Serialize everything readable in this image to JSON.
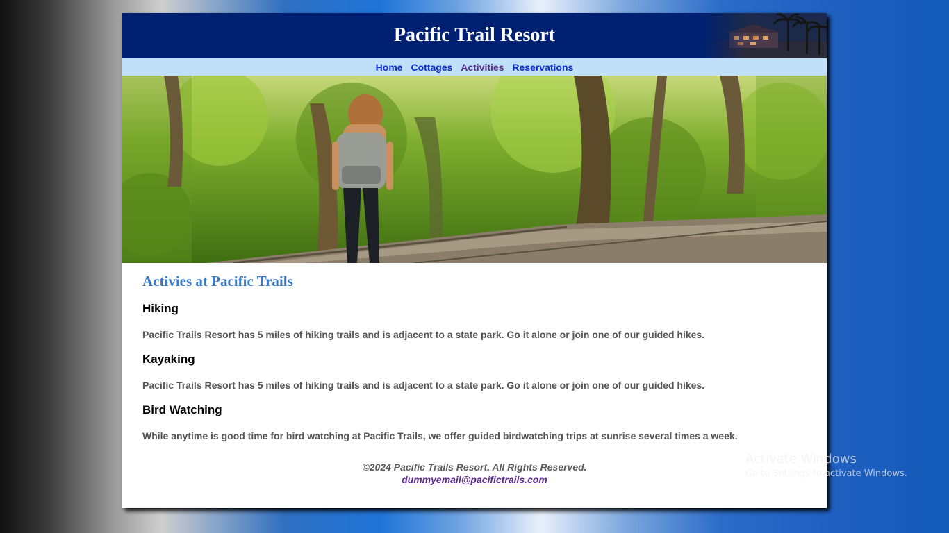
{
  "header": {
    "title": "Pacific Trail Resort"
  },
  "nav": {
    "items": [
      {
        "label": "Home",
        "visited": false
      },
      {
        "label": "Cottages",
        "visited": false
      },
      {
        "label": "Activities",
        "visited": true
      },
      {
        "label": "Reservations",
        "visited": false
      }
    ]
  },
  "main": {
    "heading": "Activies at Pacific Trails",
    "sections": [
      {
        "title": "Hiking",
        "text": "Pacific Trails Resort has 5 miles of hiking trails and is adjacent to a state park. Go it alone or join one of our guided hikes."
      },
      {
        "title": "Kayaking",
        "text": "Pacific Trails Resort has 5 miles of hiking trails and is adjacent to a state park. Go it alone or join one of our guided hikes."
      },
      {
        "title": "Bird Watching",
        "text": "While anytime is good time for bird watching at Pacific Trails, we offer guided birdwatching trips at sunrise several times a week."
      }
    ]
  },
  "footer": {
    "copyright": "©2024 Pacific Trails Resort. All Rights Reserved.",
    "email": "dummyemail@pacifictrails.com"
  },
  "watermark": {
    "line1": "Activate Windows",
    "line2": "Go to Settings to activate Windows."
  },
  "colors": {
    "header_bg": "#002171",
    "nav_bg": "#bfe0f8",
    "heading": "#3a7ac8",
    "link": "#0b2bd6",
    "visited_link": "#5b2b8c"
  }
}
